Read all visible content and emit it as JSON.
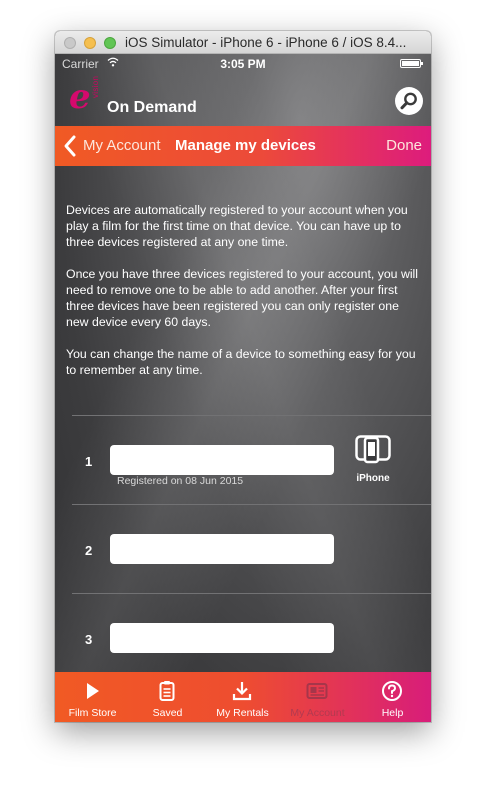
{
  "window": {
    "title": "iOS Simulator - iPhone 6 - iPhone 6 / iOS 8.4..."
  },
  "status": {
    "carrier": "Carrier",
    "time": "3:05 PM"
  },
  "app": {
    "logo_letter": "e",
    "logo_small": "vision",
    "logo_text": "On Demand"
  },
  "nav": {
    "back_label": "My Account",
    "title": "Manage my devices",
    "done_label": "Done"
  },
  "intro": {
    "p1": "Devices are automatically registered to your account when you play a film for the first time on that device.  You can have up to three devices registered at any one time.",
    "p2": "Once you have three devices registered to your account, you will need to remove one to be able to add another. After your first three devices have been registered you can only register one new device every 60 days.",
    "p3": "You can change the name of a device to something easy for you to remember at any time."
  },
  "devices": [
    {
      "number": "1",
      "name": "",
      "registered": "Registered on 08 Jun 2015",
      "type": "iPhone",
      "icon": "iphone-device-icon"
    },
    {
      "number": "2",
      "name": ""
    },
    {
      "number": "3",
      "name": ""
    }
  ],
  "tabs": [
    {
      "label": "Film Store",
      "icon": "play-icon"
    },
    {
      "label": "Saved",
      "icon": "saved-list-icon"
    },
    {
      "label": "My Rentals",
      "icon": "download-icon"
    },
    {
      "label": "My Account",
      "icon": "account-card-icon"
    },
    {
      "label": "Help",
      "icon": "help-icon"
    }
  ],
  "colors": {
    "brand_orange": "#f05a24",
    "brand_pink": "#dd1c7d",
    "active_tab_text": "#b23a50"
  }
}
